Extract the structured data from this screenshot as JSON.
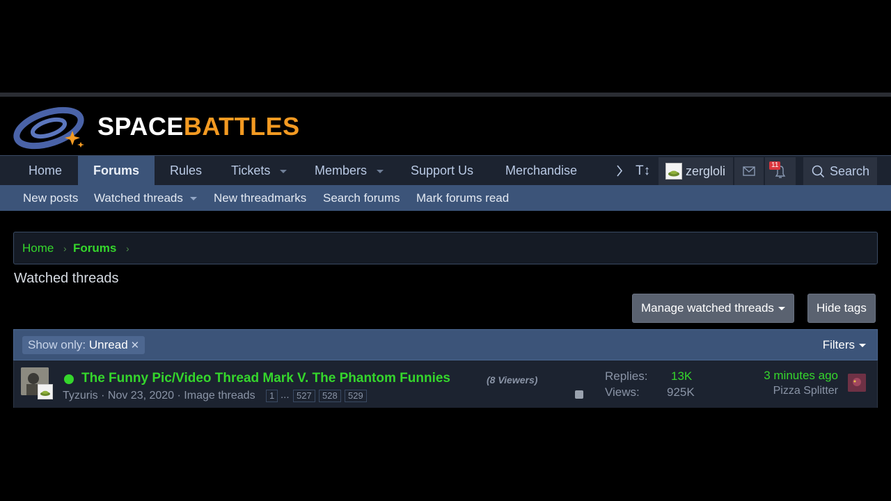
{
  "logo": {
    "word1": "SPACE",
    "word2": "BATTLES"
  },
  "nav": {
    "items": [
      {
        "label": "Home"
      },
      {
        "label": "Forums"
      },
      {
        "label": "Rules"
      },
      {
        "label": "Tickets"
      },
      {
        "label": "Members"
      },
      {
        "label": "Support Us"
      },
      {
        "label": "Merchandise"
      }
    ],
    "username": "zergloli",
    "alerts_count": "11",
    "search_label": "Search",
    "text_size_icon": "T↕"
  },
  "subnav": {
    "items": [
      {
        "label": "New posts"
      },
      {
        "label": "Watched threads"
      },
      {
        "label": "New threadmarks"
      },
      {
        "label": "Search forums"
      },
      {
        "label": "Mark forums read"
      }
    ]
  },
  "breadcrumb": {
    "items": [
      "Home",
      "Forums"
    ]
  },
  "page": {
    "title": "Watched threads",
    "manage_button": "Manage watched threads",
    "hide_tags_button": "Hide tags"
  },
  "list": {
    "filter_prefix": "Show only:",
    "filter_value": "Unread",
    "filters_label": "Filters",
    "threads": [
      {
        "title": "The Funny Pic/Video Thread Mark V. The Phantom Funnies",
        "viewers": "(8 Viewers)",
        "author": "Tyzuris",
        "date": "Nov 23, 2020",
        "forum": "Image threads",
        "pages": [
          "1",
          "...",
          "527",
          "528",
          "529"
        ],
        "replies_label": "Replies:",
        "replies": "13K",
        "views_label": "Views:",
        "views": "925K",
        "last_time": "3 minutes ago",
        "last_user": "Pizza Splitter"
      }
    ]
  },
  "colors": {
    "accent_green": "#35d62c",
    "nav_blue": "#3c5479",
    "logo_orange": "#f39a22"
  }
}
